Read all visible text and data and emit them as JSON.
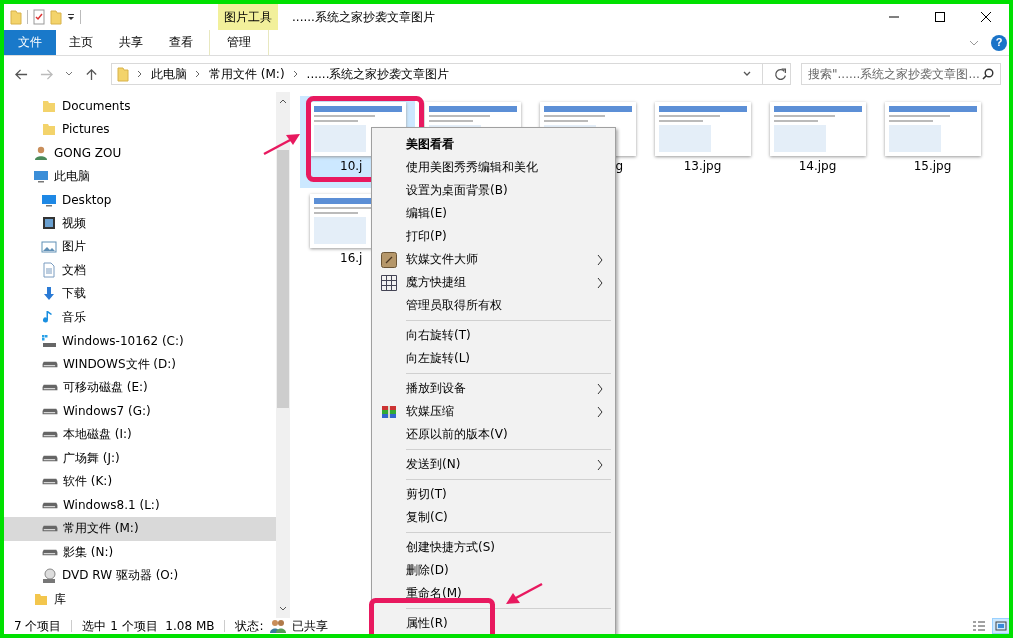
{
  "window": {
    "title": "......系统之家抄袭文章图片",
    "context_tab": "图片工具",
    "help_glyph": "?"
  },
  "ribbon_tabs": [
    {
      "label": "文件",
      "kind": "file"
    },
    {
      "label": "主页",
      "kind": "tab"
    },
    {
      "label": "共享",
      "kind": "tab"
    },
    {
      "label": "查看",
      "kind": "tab"
    },
    {
      "label": "管理",
      "kind": "context"
    }
  ],
  "address": {
    "crumbs": [
      "此电脑",
      "常用文件 (M:)",
      "......系统之家抄袭文章图片"
    ]
  },
  "search": {
    "placeholder": "搜索\"......系统之家抄袭文章图..."
  },
  "sidebar": {
    "partial_group": [
      {
        "label": "Documents",
        "kind": "folder",
        "selected": false
      },
      {
        "label": "Pictures",
        "kind": "folder",
        "selected": false
      }
    ],
    "items": [
      {
        "label": "GONG ZOU",
        "kind": "user",
        "selected": false
      },
      {
        "label": "此电脑",
        "kind": "pc",
        "selected": false,
        "children": [
          {
            "label": "Desktop",
            "kind": "desktop",
            "selected": false
          },
          {
            "label": "视频",
            "kind": "video",
            "selected": false
          },
          {
            "label": "图片",
            "kind": "pictures",
            "selected": false
          },
          {
            "label": "文档",
            "kind": "docs",
            "selected": false
          },
          {
            "label": "下载",
            "kind": "download",
            "selected": false
          },
          {
            "label": "音乐",
            "kind": "music",
            "selected": false
          },
          {
            "label": "Windows-10162 (C:)",
            "kind": "windrive",
            "selected": false
          },
          {
            "label": "WINDOWS文件 (D:)",
            "kind": "drive",
            "selected": false
          },
          {
            "label": "可移动磁盘 (E:)",
            "kind": "drive",
            "selected": false
          },
          {
            "label": "Windows7 (G:)",
            "kind": "drive",
            "selected": false
          },
          {
            "label": "本地磁盘 (I:)",
            "kind": "drive",
            "selected": false
          },
          {
            "label": "广场舞 (J:)",
            "kind": "drive",
            "selected": false
          },
          {
            "label": "软件 (K:)",
            "kind": "drive",
            "selected": false
          },
          {
            "label": "Windows8.1 (L:)",
            "kind": "drive",
            "selected": false
          },
          {
            "label": "常用文件 (M:)",
            "kind": "drive",
            "selected": true
          },
          {
            "label": "影集 (N:)",
            "kind": "drive",
            "selected": false
          },
          {
            "label": "DVD RW 驱动器 (O:)",
            "kind": "dvd",
            "selected": false
          }
        ]
      },
      {
        "label": "库",
        "kind": "library",
        "selected": false
      }
    ]
  },
  "files": [
    {
      "label": "10.j",
      "kind": "head",
      "selected": true
    },
    {
      "kind": "hidden",
      "selected": false
    },
    {
      "label": "g",
      "kind": "tail",
      "selected": false
    },
    {
      "label": "13.jpg",
      "kind": "full",
      "selected": false
    },
    {
      "label": "14.jpg",
      "kind": "full",
      "selected": false
    },
    {
      "label": "15.jpg",
      "kind": "full",
      "selected": false
    },
    {
      "label": "16.j",
      "kind": "head",
      "selected": false
    }
  ],
  "context_menu": {
    "groups": [
      [
        {
          "label": "美图看看",
          "default": true,
          "submenu": false
        },
        {
          "label": "使用美图秀秀编辑和美化",
          "default": false,
          "submenu": false
        },
        {
          "label": "设置为桌面背景(B)",
          "default": false,
          "submenu": false
        },
        {
          "label": "编辑(E)",
          "default": false,
          "submenu": false
        },
        {
          "label": "打印(P)",
          "default": false,
          "submenu": false
        },
        {
          "label": "软媒文件大师",
          "default": false,
          "submenu": true,
          "kind": "app"
        },
        {
          "label": "魔方快捷组",
          "default": false,
          "submenu": true,
          "kind": "grid"
        },
        {
          "label": "管理员取得所有权",
          "default": false,
          "submenu": false
        }
      ],
      [
        {
          "label": "向右旋转(T)",
          "default": false,
          "submenu": false
        },
        {
          "label": "向左旋转(L)",
          "default": false,
          "submenu": false
        }
      ],
      [
        {
          "label": "播放到设备",
          "default": false,
          "submenu": true
        },
        {
          "label": "软媒压缩",
          "default": false,
          "submenu": true,
          "kind": "archive"
        },
        {
          "label": "还原以前的版本(V)",
          "default": false,
          "submenu": false
        }
      ],
      [
        {
          "label": "发送到(N)",
          "default": false,
          "submenu": true
        }
      ],
      [
        {
          "label": "剪切(T)",
          "default": false,
          "submenu": false
        },
        {
          "label": "复制(C)",
          "default": false,
          "submenu": false
        }
      ],
      [
        {
          "label": "创建快捷方式(S)",
          "default": false,
          "submenu": false
        },
        {
          "label": "删除(D)",
          "default": false,
          "submenu": false
        },
        {
          "label": "重命名(M)",
          "default": false,
          "submenu": false
        }
      ],
      [
        {
          "label": "属性(R)",
          "default": false,
          "submenu": false
        }
      ]
    ]
  },
  "status_bar": {
    "count": "7 个项目",
    "selection": "选中 1 个项目  1.08 MB",
    "state_label": "状态:",
    "state": "已共享",
    "views": [
      {
        "kind": "details",
        "selected": false
      },
      {
        "kind": "large",
        "selected": true
      }
    ]
  }
}
